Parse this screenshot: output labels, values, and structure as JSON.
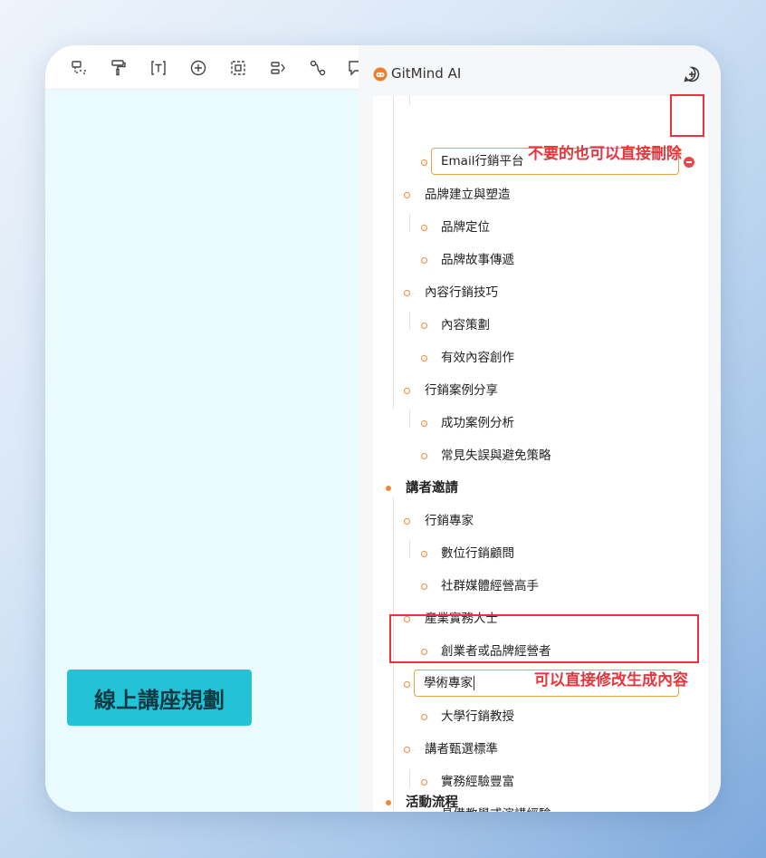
{
  "panel": {
    "app_title": "GitMind AI"
  },
  "canvas": {
    "root_node": "線上講座規劃"
  },
  "outline": {
    "editing_top": "Email行銷平台",
    "items": [
      "品牌建立與塑造",
      "品牌定位",
      "品牌故事傳遞",
      "內容行銷技巧",
      "內容策劃",
      "有效內容創作",
      "行銷案例分享",
      "成功案例分析",
      "常見失誤與避免策略",
      "講者邀請",
      "行銷專家",
      "數位行銷顧問",
      "社群媒體經營高手",
      "產業實務人士",
      "創業者或品牌經營者",
      "大學行銷教授",
      "講者甄選標準",
      "實務經驗豐富",
      "具備教學或演講經驗",
      "活動流程"
    ],
    "editing_middle": "學術專家"
  },
  "annotations": {
    "delete_hint": "不要的也可以直接刪除",
    "edit_hint": "可以直接修改生成內容"
  },
  "colors": {
    "accent": "#f0883a",
    "root_node_bg": "#22c3d6",
    "annotation": "#e8343b"
  }
}
